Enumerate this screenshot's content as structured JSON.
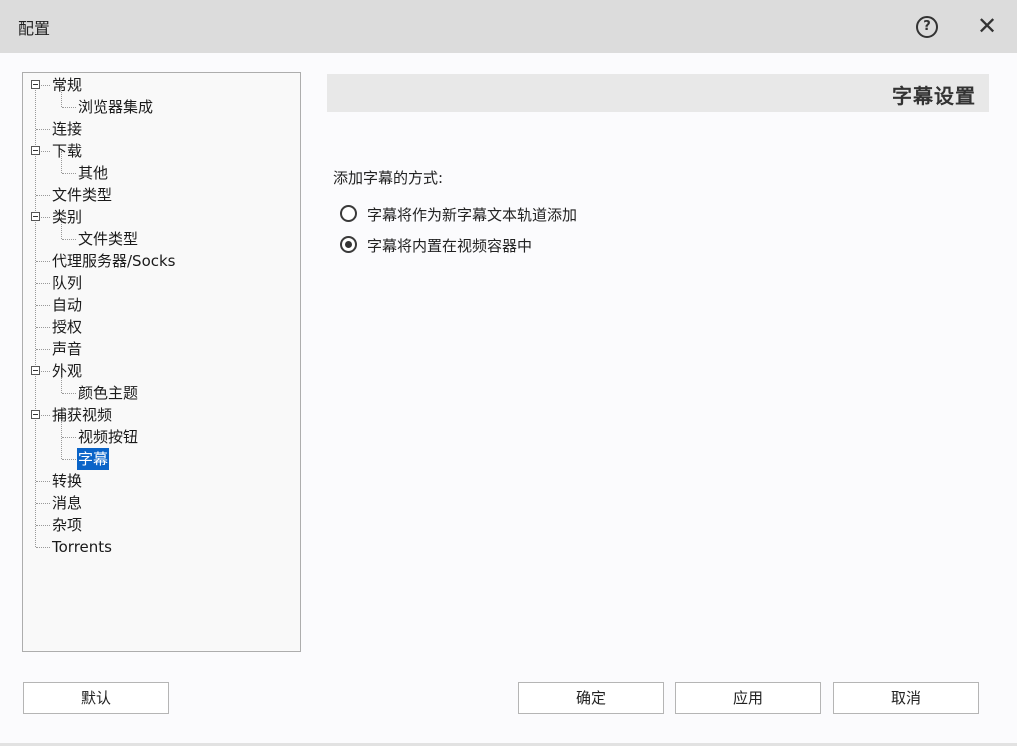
{
  "window": {
    "title": "配置",
    "help_label": "?",
    "close_label": "✕"
  },
  "tree": [
    {
      "label": "常规",
      "level": 0,
      "expandable": true
    },
    {
      "label": "浏览器集成",
      "level": 1
    },
    {
      "label": "连接",
      "level": 0
    },
    {
      "label": "下载",
      "level": 0,
      "expandable": true
    },
    {
      "label": "其他",
      "level": 1
    },
    {
      "label": "文件类型",
      "level": 0
    },
    {
      "label": "类别",
      "level": 0,
      "expandable": true
    },
    {
      "label": "文件类型",
      "level": 1
    },
    {
      "label": "代理服务器/Socks",
      "level": 0
    },
    {
      "label": "队列",
      "level": 0
    },
    {
      "label": "自动",
      "level": 0
    },
    {
      "label": "授权",
      "level": 0
    },
    {
      "label": "声音",
      "level": 0
    },
    {
      "label": "外观",
      "level": 0,
      "expandable": true
    },
    {
      "label": "颜色主题",
      "level": 1
    },
    {
      "label": "捕获视频",
      "level": 0,
      "expandable": true
    },
    {
      "label": "视频按钮",
      "level": 1
    },
    {
      "label": "字幕",
      "level": 1,
      "selected": true
    },
    {
      "label": "转换",
      "level": 0
    },
    {
      "label": "消息",
      "level": 0
    },
    {
      "label": "杂项",
      "level": 0
    },
    {
      "label": "Torrents",
      "level": 0
    }
  ],
  "content": {
    "section_title": "字幕设置",
    "group_label": "添加字幕的方式:",
    "options": [
      {
        "label": "字幕将作为新字幕文本轨道添加",
        "checked": false
      },
      {
        "label": "字幕将内置在视频容器中",
        "checked": true
      }
    ]
  },
  "buttons": {
    "default": "默认",
    "ok": "确定",
    "apply": "应用",
    "cancel": "取消"
  },
  "colors": {
    "selection": "#0a64c8",
    "titlebar": "#dcdcdc"
  }
}
